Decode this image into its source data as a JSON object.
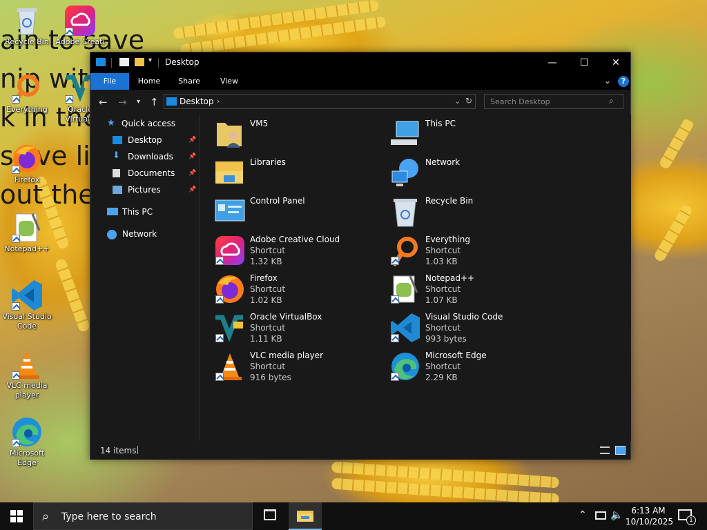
{
  "desktop": {
    "background_text": "ain to save\nnip with\nk in the\nss ve li\nout the",
    "icons": [
      {
        "label": "Recycle Bin",
        "icon": "recycle-bin-icon"
      },
      {
        "label": "Adobe Creati",
        "icon": "adobe-creative-cloud-icon"
      },
      {
        "label": "Everything",
        "icon": "everything-icon"
      },
      {
        "label": "Oracle VirtualB",
        "icon": "virtualbox-icon"
      },
      {
        "label": "Firefox",
        "icon": "firefox-icon"
      },
      {
        "label": "Notepad++",
        "icon": "notepadpp-icon"
      },
      {
        "label": "Visual Studio Code",
        "icon": "vscode-icon"
      },
      {
        "label": "VLC media player",
        "icon": "vlc-icon"
      },
      {
        "label": "Microsoft Edge",
        "icon": "edge-icon"
      }
    ]
  },
  "window": {
    "title": "Desktop",
    "controls": {
      "minimize": "—",
      "maximize": "☐",
      "close": "✕"
    },
    "ribbon_tabs": [
      "File",
      "Home",
      "Share",
      "View"
    ],
    "help": "?",
    "address": "Desktop",
    "search_placeholder": "Search Desktop",
    "nav": {
      "quick_access": "Quick access",
      "pinned": [
        "Desktop",
        "Downloads",
        "Documents",
        "Pictures"
      ],
      "this_pc": "This PC",
      "network": "Network"
    },
    "items": [
      {
        "name": "VM5",
        "type": "",
        "size": "",
        "icon": "user-folder-icon"
      },
      {
        "name": "This PC",
        "type": "",
        "size": "",
        "icon": "this-pc-icon"
      },
      {
        "name": "Libraries",
        "type": "",
        "size": "",
        "icon": "libraries-icon"
      },
      {
        "name": "Network",
        "type": "",
        "size": "",
        "icon": "network-icon"
      },
      {
        "name": "Control Panel",
        "type": "",
        "size": "",
        "icon": "control-panel-icon"
      },
      {
        "name": "Recycle Bin",
        "type": "",
        "size": "",
        "icon": "recycle-bin-icon"
      },
      {
        "name": "Adobe Creative Cloud",
        "type": "Shortcut",
        "size": "1.32 KB",
        "icon": "adobe-creative-cloud-icon"
      },
      {
        "name": "Everything",
        "type": "Shortcut",
        "size": "1.03 KB",
        "icon": "everything-icon"
      },
      {
        "name": "Firefox",
        "type": "Shortcut",
        "size": "1.02 KB",
        "icon": "firefox-icon"
      },
      {
        "name": "Notepad++",
        "type": "Shortcut",
        "size": "1.07 KB",
        "icon": "notepadpp-icon"
      },
      {
        "name": "Oracle VirtualBox",
        "type": "Shortcut",
        "size": "1.11 KB",
        "icon": "virtualbox-icon"
      },
      {
        "name": "Visual Studio Code",
        "type": "Shortcut",
        "size": "993 bytes",
        "icon": "vscode-icon"
      },
      {
        "name": "VLC media player",
        "type": "Shortcut",
        "size": "916 bytes",
        "icon": "vlc-icon"
      },
      {
        "name": "Microsoft Edge",
        "type": "Shortcut",
        "size": "2.29 KB",
        "icon": "edge-icon"
      }
    ],
    "status": "14 items"
  },
  "taskbar": {
    "search_text": "Type here to search",
    "time": "6:13 AM",
    "date": "10/10/2025",
    "notification_count": "1"
  },
  "colors": {
    "accent": "#1a73d3",
    "window_bg": "#191919",
    "titlebar_bg": "#000000",
    "taskbar_bg": "#101010"
  }
}
